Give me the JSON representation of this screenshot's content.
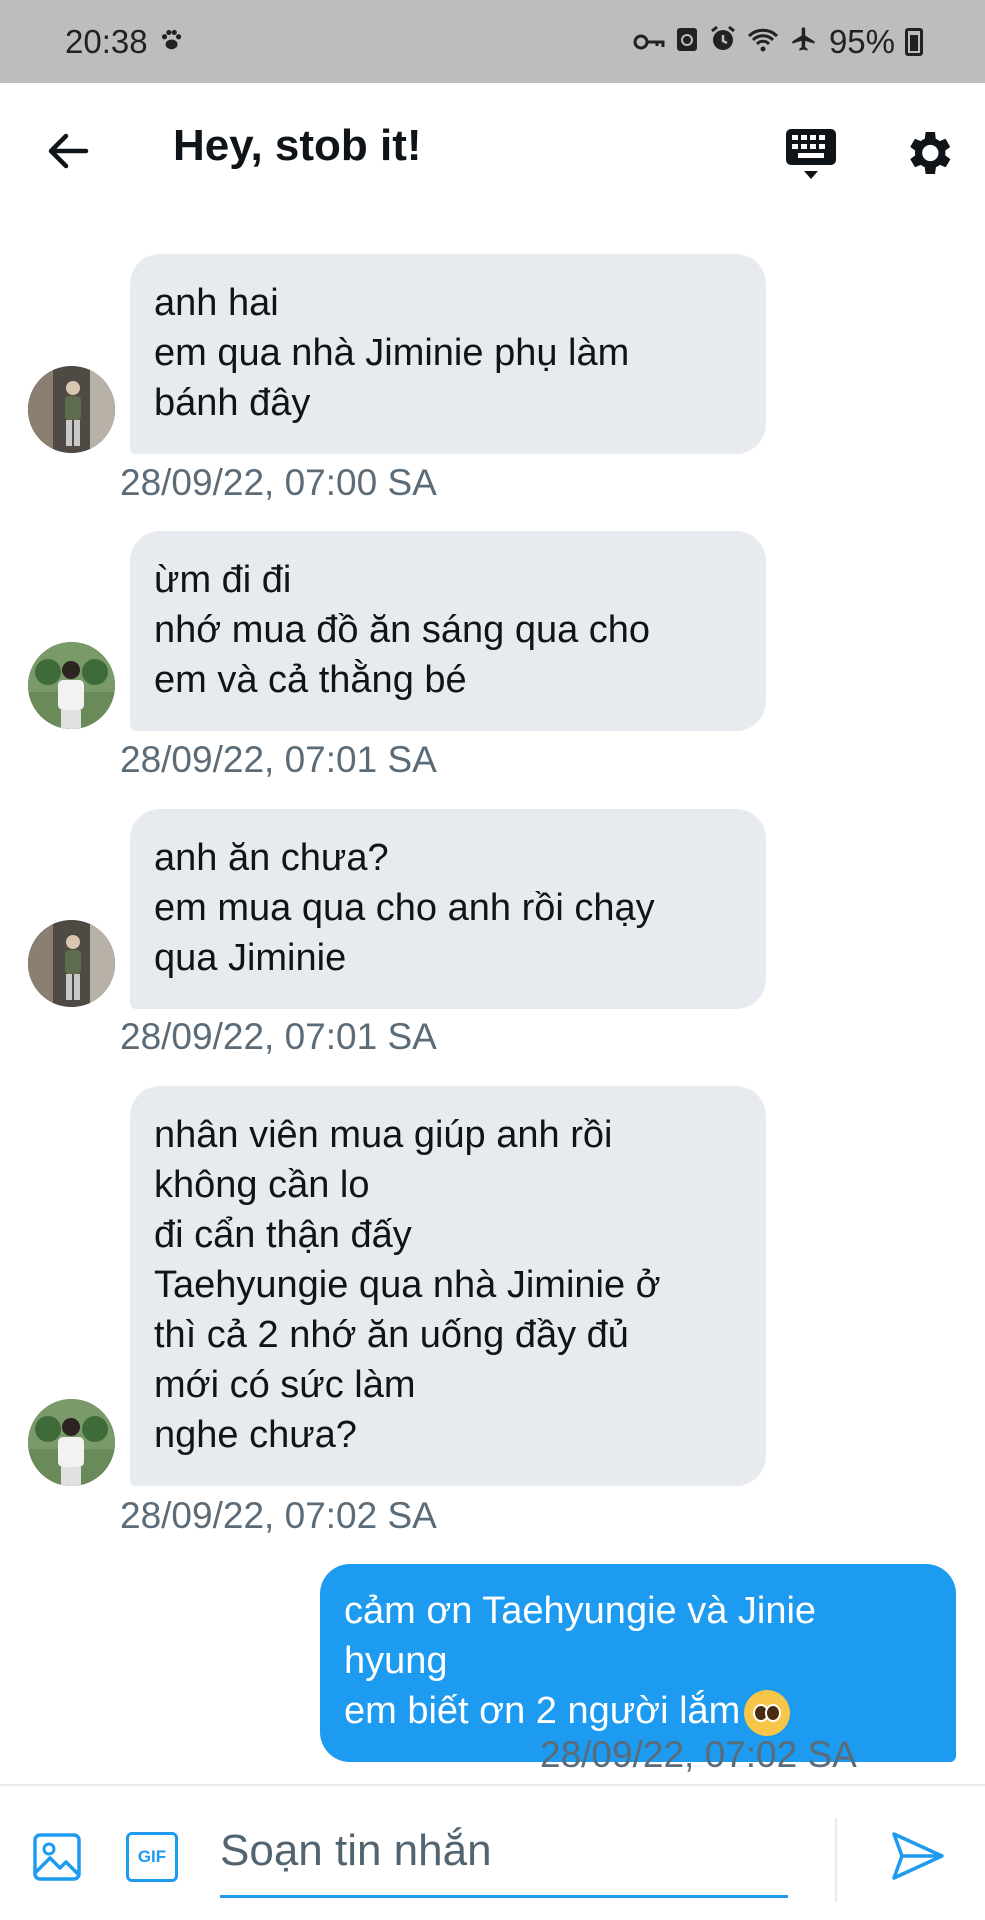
{
  "status_bar": {
    "time": "20:38",
    "battery": "95%"
  },
  "header": {
    "title": "Hey, stob it!"
  },
  "messages": [
    {
      "direction": "in",
      "avatar": "avatar-user-a",
      "text": "anh hai\nem qua nhà Jiminie phụ làm\nbánh đây",
      "time": "28/09/22, 07:00 SA"
    },
    {
      "direction": "in",
      "avatar": "avatar-user-b",
      "text": "ừm đi đi\nnhớ mua đồ ăn sáng qua cho\nem và cả thằng bé",
      "time": "28/09/22, 07:01 SA"
    },
    {
      "direction": "in",
      "avatar": "avatar-user-a",
      "text": "anh ăn chưa?\nem mua qua cho anh rồi chạy\nqua Jiminie",
      "time": "28/09/22, 07:01 SA"
    },
    {
      "direction": "in",
      "avatar": "avatar-user-b",
      "text": "nhân viên mua giúp anh rồi\nkhông cần lo\nđi cẩn thận đấy\nTaehyungie qua nhà Jiminie ở\nthì cả 2 nhớ ăn uống đầy đủ\nmới có sức làm\nnghe chưa?",
      "time": "28/09/22, 07:02 SA"
    },
    {
      "direction": "out",
      "text": "cảm ơn Taehyungie và Jinie\nhyung\nem biết ơn 2 người lắm",
      "emoji": "pleading-face-emoji",
      "time": "28/09/22, 07:02 SA"
    }
  ],
  "composer": {
    "placeholder": "Soạn tin nhắn",
    "gif_label": "GIF"
  },
  "colors": {
    "accent": "#1d9bf0",
    "incoming_bubble": "#e7ebef",
    "timestamp": "#5b6b78",
    "status_bar": "#bdbdbd"
  }
}
